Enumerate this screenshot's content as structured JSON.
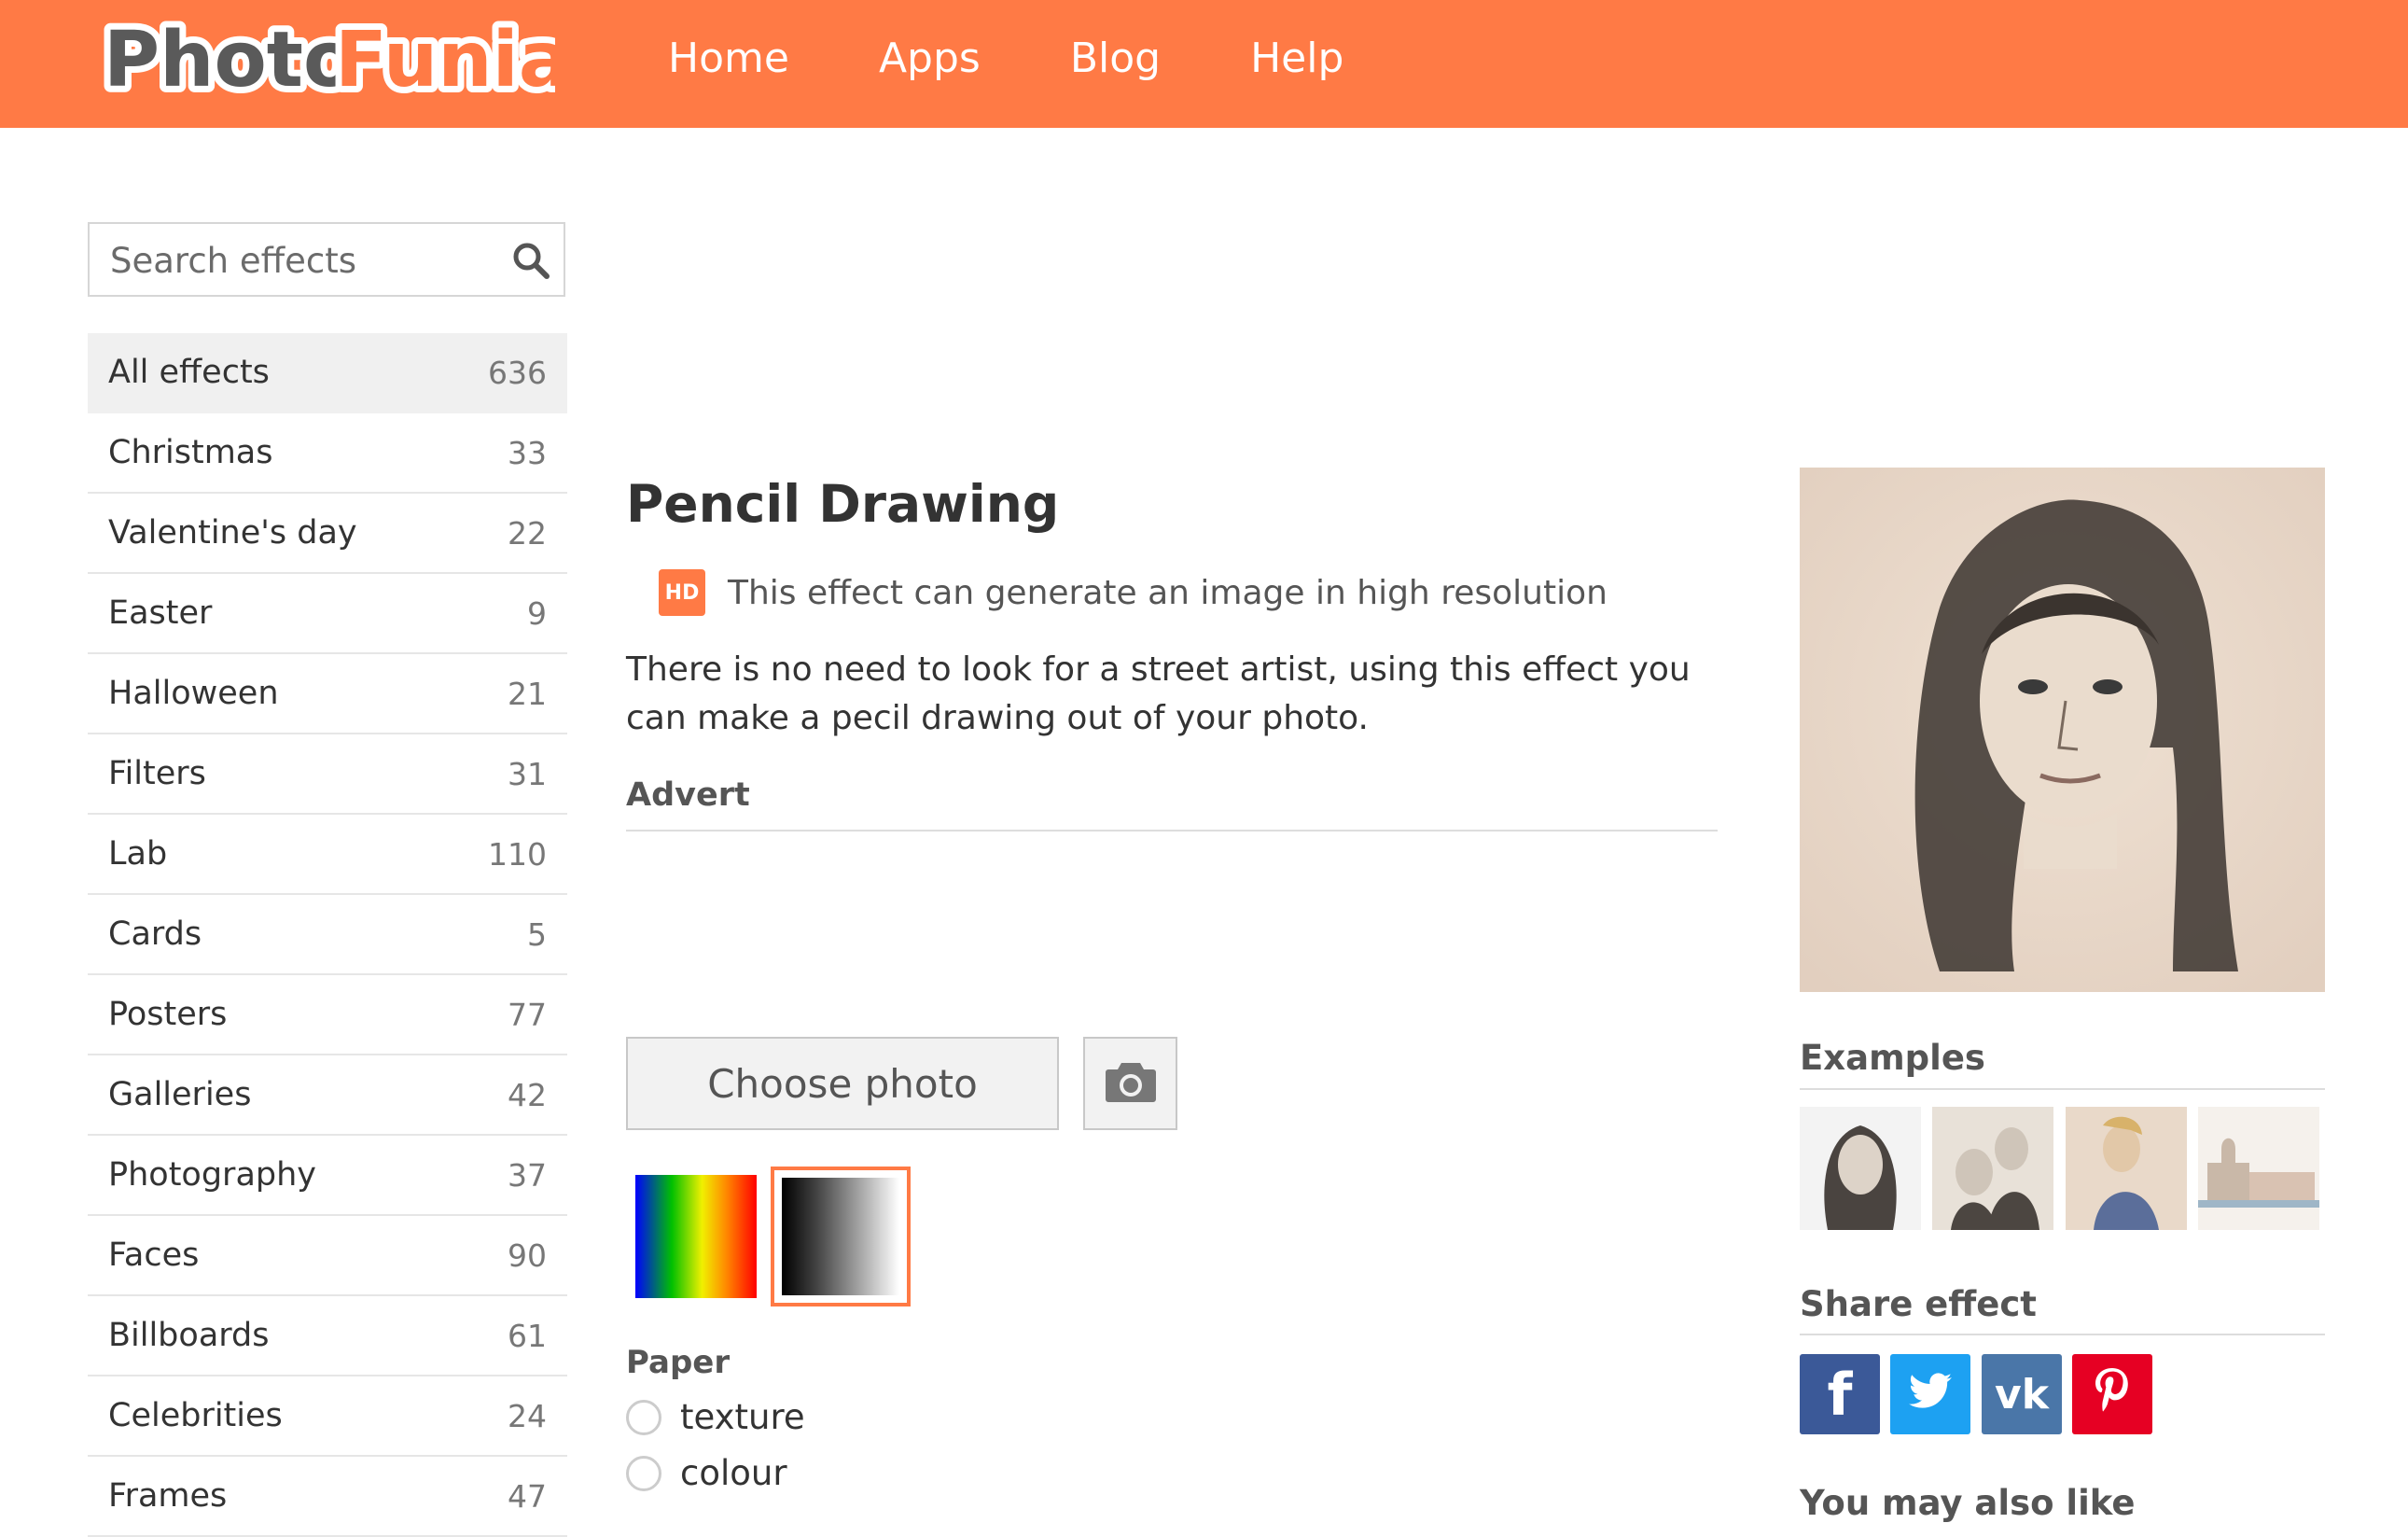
{
  "header": {
    "logo": {
      "part1": "Photo",
      "part2": "Funia"
    },
    "nav": [
      "Home",
      "Apps",
      "Blog",
      "Help"
    ]
  },
  "sidebar": {
    "search_placeholder": "Search effects",
    "categories": [
      {
        "label": "All effects",
        "count": "636",
        "active": true
      },
      {
        "label": "Christmas",
        "count": "33"
      },
      {
        "label": "Valentine's day",
        "count": "22"
      },
      {
        "label": "Easter",
        "count": "9"
      },
      {
        "label": "Halloween",
        "count": "21"
      },
      {
        "label": "Filters",
        "count": "31"
      },
      {
        "label": "Lab",
        "count": "110"
      },
      {
        "label": "Cards",
        "count": "5"
      },
      {
        "label": "Posters",
        "count": "77"
      },
      {
        "label": "Galleries",
        "count": "42"
      },
      {
        "label": "Photography",
        "count": "37"
      },
      {
        "label": "Faces",
        "count": "90"
      },
      {
        "label": "Billboards",
        "count": "61"
      },
      {
        "label": "Celebrities",
        "count": "24"
      },
      {
        "label": "Frames",
        "count": "47"
      }
    ]
  },
  "effect": {
    "title": "Pencil Drawing",
    "hd_badge": "HD",
    "hd_text": "This effect can generate an image in high resolution",
    "description": "There is no need to look for a street artist, using this effect you can make a pecil drawing out of your photo.",
    "advert_label": "Advert",
    "choose_photo": "Choose photo",
    "paper_label": "Paper",
    "paper_options": [
      "texture",
      "colour"
    ]
  },
  "right": {
    "examples_title": "Examples",
    "share_title": "Share effect",
    "share_fb": "f",
    "share_vk": "vk",
    "more_title": "You may also like"
  },
  "colors": {
    "brand": "#ff7a45",
    "facebook": "#3b5998",
    "twitter": "#1da1f2",
    "vk": "#4a76a8",
    "pinterest": "#e60023"
  }
}
